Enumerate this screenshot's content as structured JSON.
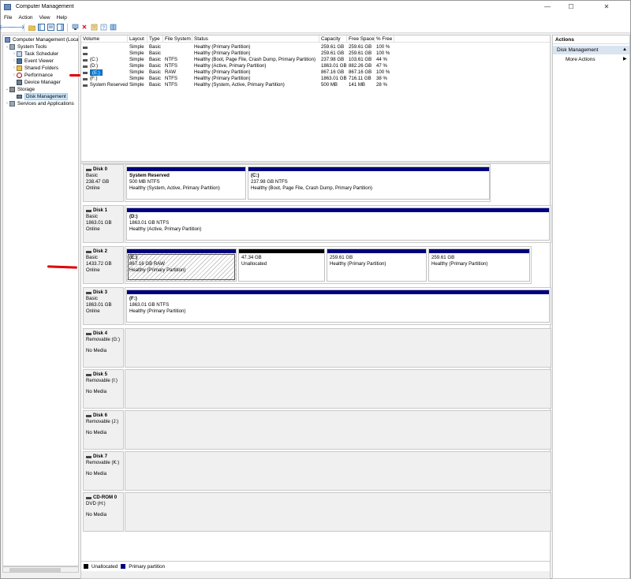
{
  "window": {
    "title": "Computer Management",
    "minimize_glyph": "—",
    "maximize_glyph": "☐",
    "close_glyph": "✕"
  },
  "menu": [
    "File",
    "Action",
    "View",
    "Help"
  ],
  "toolbar_icons": [
    "back-icon",
    "forward-icon",
    "up-folder-icon",
    "show-tree-icon",
    "properties-icon",
    "console-tree-icon",
    "connect-icon",
    "delete-icon",
    "properties-sheet-icon",
    "help-icon",
    "help-book-icon"
  ],
  "tree": {
    "root": "Computer Management (Local",
    "items": [
      {
        "label": "System Tools",
        "level": 1,
        "expander": "⌄"
      },
      {
        "label": "Task Scheduler",
        "level": 2,
        "expander": "›"
      },
      {
        "label": "Event Viewer",
        "level": 2,
        "expander": "›"
      },
      {
        "label": "Shared Folders",
        "level": 2,
        "expander": "›"
      },
      {
        "label": "Performance",
        "level": 2,
        "expander": "›"
      },
      {
        "label": "Device Manager",
        "level": 2,
        "expander": ""
      },
      {
        "label": "Storage",
        "level": 1,
        "expander": "⌄"
      },
      {
        "label": "Disk Management",
        "level": 2,
        "expander": ""
      },
      {
        "label": "Services and Applications",
        "level": 1,
        "expander": "›"
      }
    ]
  },
  "volume_table": {
    "headers": [
      "Volume",
      "Layout",
      "Type",
      "File System",
      "Status",
      "Capacity",
      "Free Space",
      "% Free"
    ],
    "rows": [
      [
        "",
        "Simple",
        "Basic",
        "",
        "Healthy (Primary Partition)",
        "259.61 GB",
        "259.61 GB",
        "100 %"
      ],
      [
        "",
        "Simple",
        "Basic",
        "",
        "Healthy (Primary Partition)",
        "259.61 GB",
        "259.61 GB",
        "100 %"
      ],
      [
        "(C:)",
        "Simple",
        "Basic",
        "NTFS",
        "Healthy (Boot, Page File, Crash Dump, Primary Partition)",
        "237.98 GB",
        "103.61 GB",
        "44 %"
      ],
      [
        "(D:)",
        "Simple",
        "Basic",
        "NTFS",
        "Healthy (Active, Primary Partition)",
        "1863.01 GB",
        "882.26 GB",
        "47 %"
      ],
      [
        "(E:)",
        "Simple",
        "Basic",
        "RAW",
        "Healthy (Primary Partition)",
        "867.16 GB",
        "867.16 GB",
        "100 %"
      ],
      [
        "(F:)",
        "Simple",
        "Basic",
        "NTFS",
        "Healthy (Primary Partition)",
        "1863.01 GB",
        "716.11 GB",
        "38 %"
      ],
      [
        "System Reserved",
        "Simple",
        "Basic",
        "NTFS",
        "Healthy (System, Active, Primary Partition)",
        "500 MB",
        "141 MB",
        "28 %"
      ]
    ]
  },
  "disks": [
    {
      "name": "Disk 0",
      "type": "Basic",
      "size": "238.47 GB",
      "status": "Online",
      "partitions": [
        {
          "title": "System Reserved",
          "line2": "500 MB NTFS",
          "line3": "Healthy (System, Active, Primary Partition)"
        },
        {
          "title": "(C:)",
          "line2": "237.98 GB NTFS",
          "line3": "Healthy (Boot, Page File, Crash Dump, Primary Partition)"
        }
      ]
    },
    {
      "name": "Disk 1",
      "type": "Basic",
      "size": "1863.01 GB",
      "status": "Online",
      "partitions": [
        {
          "title": "(D:)",
          "line2": "1863.01 GB NTFS",
          "line3": "Healthy (Active, Primary Partition)"
        }
      ]
    },
    {
      "name": "Disk 2",
      "type": "Basic",
      "size": "1433.72 GB",
      "status": "Online",
      "partitions": [
        {
          "title": "(E:)",
          "line2": "867.16 GB RAW",
          "line3": "Healthy (Primary Partition)"
        },
        {
          "title": "",
          "line2": "47.34 GB",
          "line3": "Unallocated"
        },
        {
          "title": "",
          "line2": "259.61 GB",
          "line3": "Healthy (Primary Partition)"
        },
        {
          "title": "",
          "line2": "259.61 GB",
          "line3": "Healthy (Primary Partition)"
        }
      ]
    },
    {
      "name": "Disk 3",
      "type": "Basic",
      "size": "1863.01 GB",
      "status": "Online",
      "partitions": [
        {
          "title": "(F:)",
          "line2": "1863.01 GB NTFS",
          "line3": "Healthy (Primary Partition)"
        }
      ]
    },
    {
      "name": "Disk 4",
      "type": "Removable (G:)",
      "size": "",
      "status": "No Media",
      "partitions": []
    },
    {
      "name": "Disk 5",
      "type": "Removable (I:)",
      "size": "",
      "status": "No Media",
      "partitions": []
    },
    {
      "name": "Disk 6",
      "type": "Removable (J:)",
      "size": "",
      "status": "No Media",
      "partitions": []
    },
    {
      "name": "Disk 7",
      "type": "Removable (K:)",
      "size": "",
      "status": "No Media",
      "partitions": []
    },
    {
      "name": "CD-ROM 0",
      "type": "DVD (H:)",
      "size": "",
      "status": "No Media",
      "partitions": []
    }
  ],
  "legend": {
    "items": [
      {
        "label": "Unallocated",
        "color": "#000000"
      },
      {
        "label": "Primary partition",
        "color": "#00007f"
      }
    ]
  },
  "actions": {
    "header": "Actions",
    "section": "Disk Management",
    "items": [
      "More Actions"
    ]
  },
  "colors": {
    "primary_partition": "#00007f",
    "unallocated": "#000000",
    "selection": "#0078d7",
    "annotation": "#e00000"
  }
}
